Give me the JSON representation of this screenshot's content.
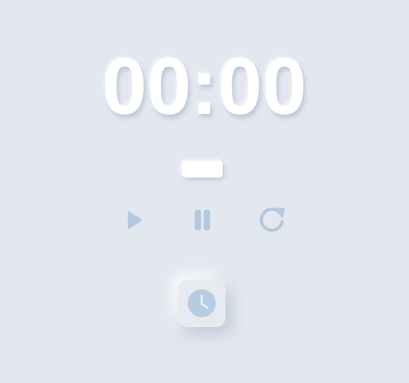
{
  "timer": {
    "display": "00:00"
  },
  "controls": {
    "play_icon": "play-icon",
    "pause_icon": "pause-icon",
    "reset_icon": "reset-icon",
    "clock_icon": "clock-icon"
  },
  "colors": {
    "background": "#e3e7ef",
    "digits": "#ffffff",
    "icon": "#b3c8df",
    "clock_face": "#b7cce1"
  }
}
